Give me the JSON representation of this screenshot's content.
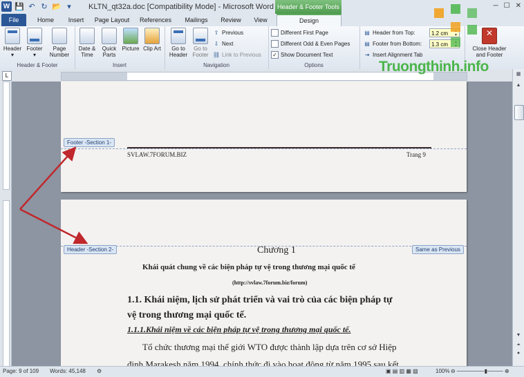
{
  "window": {
    "title": "KLTN_qt32a.doc [Compatibility Mode] - Microsoft Word",
    "contextual_tab_group": "Header & Footer Tools",
    "app_icon": "W"
  },
  "tabs": [
    "File",
    "Home",
    "Insert",
    "Page Layout",
    "References",
    "Mailings",
    "Review",
    "View",
    "Design"
  ],
  "ribbon": {
    "groups": {
      "header_footer": "Header & Footer",
      "insert": "Insert",
      "navigation": "Navigation",
      "options": "Options"
    },
    "buttons": {
      "header": "Header",
      "footer": "Footer",
      "page_number": "Page Number",
      "date_time": "Date & Time",
      "quick_parts": "Quick Parts",
      "picture": "Picture",
      "clip_art": "Clip Art",
      "go_to_header": "Go to Header",
      "go_to_footer": "Go to Footer",
      "previous": "Previous",
      "next": "Next",
      "link_to_previous": "Link to Previous",
      "different_first_page": "Different First Page",
      "different_odd_even": "Different Odd & Even Pages",
      "show_document_text": "Show Document Text",
      "header_from_top": "Header from Top:",
      "header_from_top_value": "1.2 cm",
      "footer_from_bottom": "Footer from Bottom:",
      "footer_from_bottom_value": "1.3 cm",
      "insert_alignment_tab": "Insert Alignment Tab",
      "close_header_footer": "Close Header and Footer"
    }
  },
  "document": {
    "footer_tag": "Footer -Section 1-",
    "footer_left": "SVLAW.7FORUM.BIZ",
    "footer_right": "Trang 9",
    "header_tag": "Header -Section 2-",
    "same_as_previous": "Same as Previous",
    "chapter": "Chương 1",
    "heading_main": "Khái quát chung về các biện pháp tự vệ trong thương mại quốc tế",
    "source_url": "(http://svlaw.7forum.biz/forum)",
    "section_1_1_line1": "1.1. Khái niệm, lịch sử phát triển và vai trò của các biện pháp tự",
    "section_1_1_line2": "vệ trong thương mại quốc tế.",
    "section_1_1_1": "1.1.1.Khái niệm về các biện pháp tự vệ trong thương mại quốc tế.",
    "body_line1": "Tổ chức thương mại thế giới WTO được thành lập dựa trên cơ sở Hiệp",
    "body_line2": "định Marakesh năm 1994, chính thức đi vào hoạt động từ năm 1995 sau kết"
  },
  "status": {
    "page": "Page: 9 of 109",
    "words": "Words: 45,148",
    "zoom": "100%"
  },
  "watermark": "Truongthinh.info",
  "colors": {
    "accent": "#2b5797",
    "contextual": "#5da85d",
    "tag_border": "#8aa3c7",
    "annotation_arrow": "#c0282d"
  }
}
